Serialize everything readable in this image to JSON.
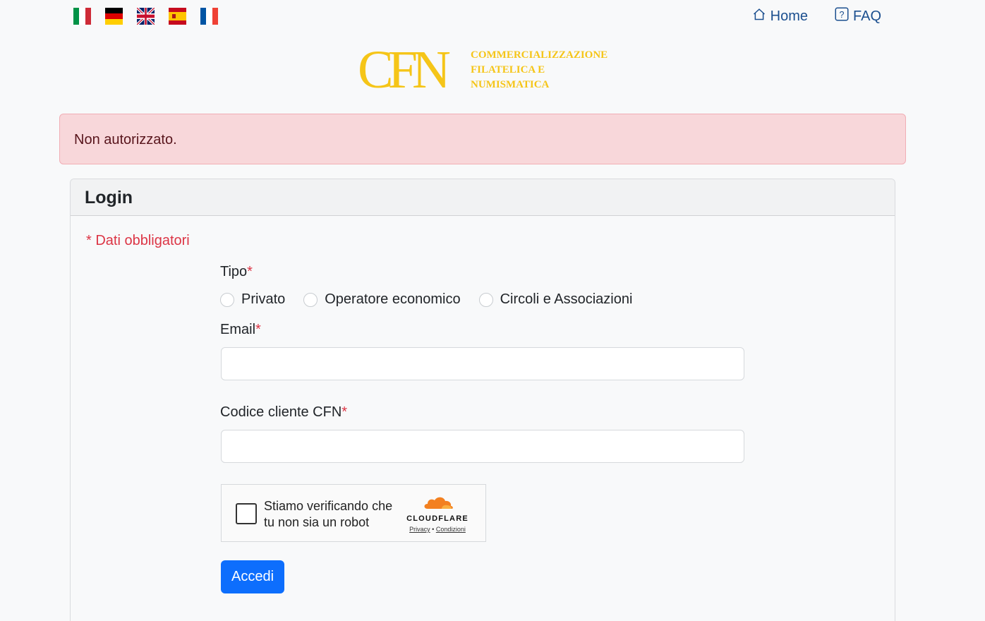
{
  "languages": [
    {
      "code": "it",
      "icon": "italy-flag-icon"
    },
    {
      "code": "de",
      "icon": "germany-flag-icon"
    },
    {
      "code": "en",
      "icon": "uk-flag-icon"
    },
    {
      "code": "es",
      "icon": "spain-flag-icon"
    },
    {
      "code": "fr",
      "icon": "france-flag-icon"
    }
  ],
  "nav": {
    "home_label": "Home",
    "home_icon": "home-icon",
    "faq_label": "FAQ",
    "faq_icon": "question-square-icon"
  },
  "logo": {
    "mark": "CFN",
    "line1": "COMMERCIALIZZAZIONE",
    "line2": "FILATELICA E",
    "line3": "NUMISMATICA",
    "color": "#f5c518"
  },
  "alert": {
    "message": "Non autorizzato."
  },
  "login": {
    "title": "Login",
    "required_note": "* Dati obbligatori",
    "tipo_label": "Tipo",
    "required_marker": "*",
    "tipo_options": [
      "Privato",
      "Operatore economico",
      "Circoli e Associazioni"
    ],
    "email_label": "Email",
    "email_value": "",
    "codice_label": "Codice cliente CFN",
    "codice_value": "",
    "submit_label": "Accedi"
  },
  "captcha": {
    "text_line1": "Stiamo verificando che",
    "text_line2": "tu non sia un robot",
    "brand": "CLOUDFLARE",
    "privacy": "Privacy",
    "separator": "•",
    "terms": "Condizioni"
  },
  "colors": {
    "primary": "#0d6efd",
    "danger": "#dc3545",
    "alert_bg": "#f8d7da",
    "cloudflare_orange": "#f38020"
  }
}
